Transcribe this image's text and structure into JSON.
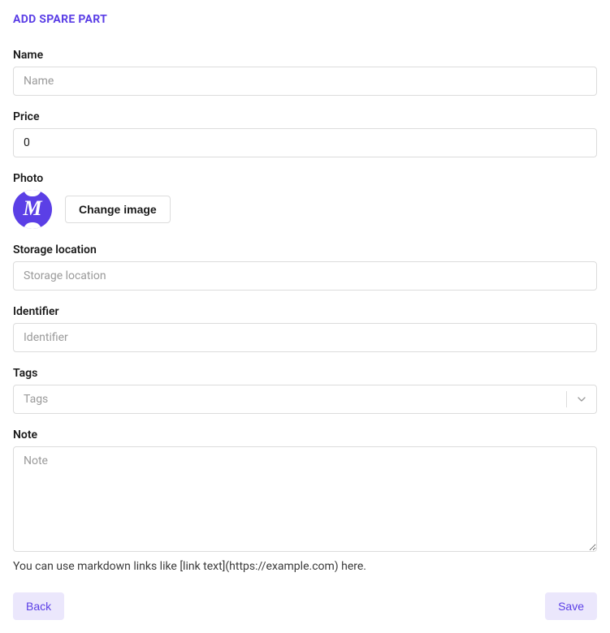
{
  "title": "ADD SPARE PART",
  "fields": {
    "name": {
      "label": "Name",
      "placeholder": "Name",
      "value": ""
    },
    "price": {
      "label": "Price",
      "value": "0"
    },
    "photo": {
      "label": "Photo",
      "change_label": "Change image"
    },
    "storage": {
      "label": "Storage location",
      "placeholder": "Storage location",
      "value": ""
    },
    "identifier": {
      "label": "Identifier",
      "placeholder": "Identifier",
      "value": ""
    },
    "tags": {
      "label": "Tags",
      "placeholder": "Tags",
      "value": ""
    },
    "note": {
      "label": "Note",
      "placeholder": "Note",
      "value": "",
      "help": "You can use markdown links like [link text](https://example.com) here."
    }
  },
  "buttons": {
    "back": "Back",
    "save": "Save"
  },
  "colors": {
    "accent": "#5b3fe6"
  }
}
